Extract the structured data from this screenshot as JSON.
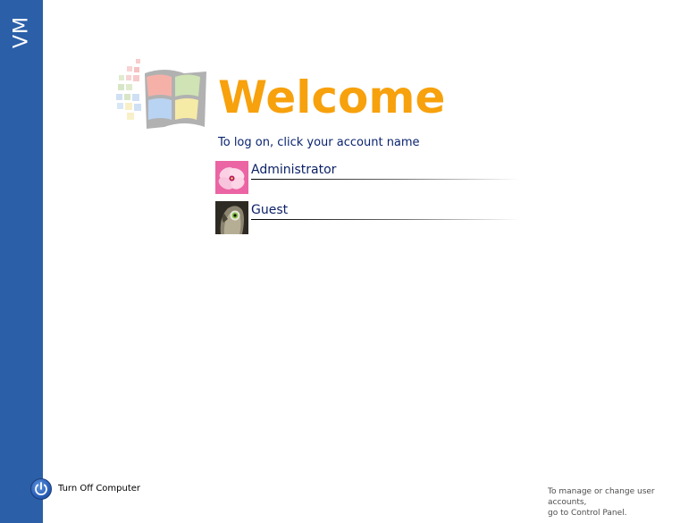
{
  "sidebar": {
    "label": "VM",
    "color": "#2b5fa8"
  },
  "welcome": {
    "title": "Welcome",
    "subtitle": "To log on, click your account name",
    "title_color": "#f7a10d"
  },
  "accounts": [
    {
      "name": "Administrator",
      "avatar": "pink-flower-avatar"
    },
    {
      "name": "Guest",
      "avatar": "parrot-avatar"
    }
  ],
  "footer": {
    "turn_off_label": "Turn Off Computer",
    "turn_off_icon": "power-icon",
    "hint_line1": "To manage or change user accounts,",
    "hint_line2": "go to Control Panel."
  },
  "logo": {
    "icon": "windows-flag-icon"
  }
}
